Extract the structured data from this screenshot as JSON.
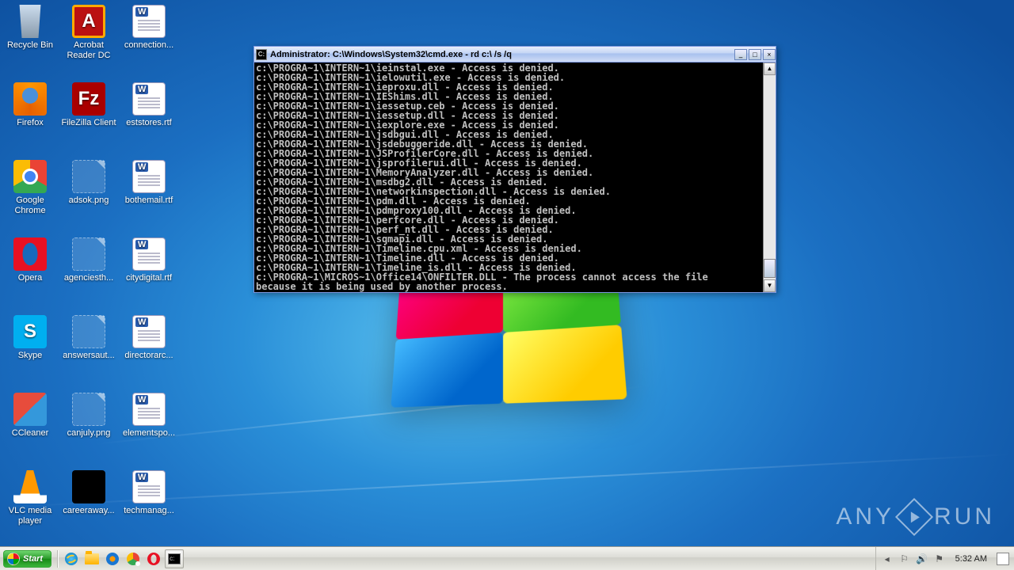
{
  "desktop_icons": [
    {
      "id": "recycle-bin",
      "label": "Recycle Bin",
      "icon": "ico-bin",
      "col": 0,
      "row": 0
    },
    {
      "id": "acrobat",
      "label": "Acrobat Reader DC",
      "icon": "ico-adobe",
      "col": 1,
      "row": 0
    },
    {
      "id": "connection",
      "label": "connection...",
      "icon": "ico-doc",
      "col": 2,
      "row": 0
    },
    {
      "id": "firefox",
      "label": "Firefox",
      "icon": "ico-firefox",
      "col": 0,
      "row": 1
    },
    {
      "id": "filezilla",
      "label": "FileZilla Client",
      "icon": "ico-filezilla",
      "col": 1,
      "row": 1
    },
    {
      "id": "eststores",
      "label": "eststores.rtf",
      "icon": "ico-doc",
      "col": 2,
      "row": 1
    },
    {
      "id": "chrome",
      "label": "Google Chrome",
      "icon": "ico-chrome",
      "col": 0,
      "row": 2
    },
    {
      "id": "adsok",
      "label": "adsok.png",
      "icon": "ico-generic",
      "col": 1,
      "row": 2
    },
    {
      "id": "bothemail",
      "label": "bothemail.rtf",
      "icon": "ico-doc",
      "col": 2,
      "row": 2
    },
    {
      "id": "opera",
      "label": "Opera",
      "icon": "ico-opera",
      "col": 0,
      "row": 3
    },
    {
      "id": "agenciesth",
      "label": "agenciesth...",
      "icon": "ico-generic",
      "col": 1,
      "row": 3
    },
    {
      "id": "citydigital",
      "label": "citydigital.rtf",
      "icon": "ico-doc",
      "col": 2,
      "row": 3
    },
    {
      "id": "skype",
      "label": "Skype",
      "icon": "ico-skype",
      "col": 0,
      "row": 4
    },
    {
      "id": "answersaut",
      "label": "answersaut...",
      "icon": "ico-generic",
      "col": 1,
      "row": 4
    },
    {
      "id": "directorarc",
      "label": "directorarc...",
      "icon": "ico-doc",
      "col": 2,
      "row": 4
    },
    {
      "id": "ccleaner",
      "label": "CCleaner",
      "icon": "ico-ccleaner",
      "col": 0,
      "row": 5
    },
    {
      "id": "canjuly",
      "label": "canjuly.png",
      "icon": "ico-generic",
      "col": 1,
      "row": 5
    },
    {
      "id": "elementspo",
      "label": "elementspo...",
      "icon": "ico-doc",
      "col": 2,
      "row": 5
    },
    {
      "id": "vlc",
      "label": "VLC media player",
      "icon": "ico-vlc",
      "col": 0,
      "row": 6
    },
    {
      "id": "careeraway",
      "label": "careeraway...",
      "icon": "ico-black",
      "col": 1,
      "row": 6
    },
    {
      "id": "techmanag",
      "label": "techmanag...",
      "icon": "ico-doc",
      "col": 2,
      "row": 6
    }
  ],
  "cmd": {
    "title": "Administrator: C:\\Windows\\System32\\cmd.exe - rd  c:\\ /s /q",
    "lines": [
      "c:\\PROGRA~1\\INTERN~1\\ieinstal.exe - Access is denied.",
      "c:\\PROGRA~1\\INTERN~1\\ielowutil.exe - Access is denied.",
      "c:\\PROGRA~1\\INTERN~1\\ieproxu.dll - Access is denied.",
      "c:\\PROGRA~1\\INTERN~1\\IEShims.dll - Access is denied.",
      "c:\\PROGRA~1\\INTERN~1\\iessetup.ceb - Access is denied.",
      "c:\\PROGRA~1\\INTERN~1\\iessetup.dll - Access is denied.",
      "c:\\PROGRA~1\\INTERN~1\\iexplore.exe - Access is denied.",
      "c:\\PROGRA~1\\INTERN~1\\jsdbgui.dll - Access is denied.",
      "c:\\PROGRA~1\\INTERN~1\\jsdebuggeride.dll - Access is denied.",
      "c:\\PROGRA~1\\INTERN~1\\JSProfilerCore.dll - Access is denied.",
      "c:\\PROGRA~1\\INTERN~1\\jsprofilerui.dll - Access is denied.",
      "c:\\PROGRA~1\\INTERN~1\\MemoryAnalyzer.dll - Access is denied.",
      "c:\\PROGRA~1\\INTERN~1\\msdbg2.dll - Access is denied.",
      "c:\\PROGRA~1\\INTERN~1\\networkinspection.dll - Access is denied.",
      "c:\\PROGRA~1\\INTERN~1\\pdm.dll - Access is denied.",
      "c:\\PROGRA~1\\INTERN~1\\pdmproxy100.dll - Access is denied.",
      "c:\\PROGRA~1\\INTERN~1\\perfcore.dll - Access is denied.",
      "c:\\PROGRA~1\\INTERN~1\\perf_nt.dll - Access is denied.",
      "c:\\PROGRA~1\\INTERN~1\\sqmapi.dll - Access is denied.",
      "c:\\PROGRA~1\\INTERN~1\\Timeline.cpu.xml - Access is denied.",
      "c:\\PROGRA~1\\INTERN~1\\Timeline.dll - Access is denied.",
      "c:\\PROGRA~1\\INTERN~1\\Timeline_is.dll - Access is denied.",
      "c:\\PROGRA~1\\MICROS~1\\Office14\\ONFILTER.DLL - The process cannot access the file",
      "because it is being used by another process."
    ]
  },
  "taskbar": {
    "start_label": "Start",
    "clock": "5:32 AM"
  },
  "watermark": {
    "left": "ANY",
    "right": "RUN"
  }
}
